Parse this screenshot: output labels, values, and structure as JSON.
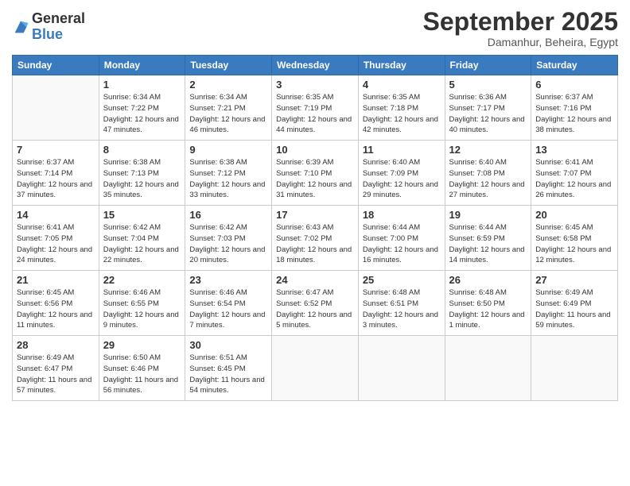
{
  "logo": {
    "general": "General",
    "blue": "Blue"
  },
  "title": "September 2025",
  "location": "Damanhur, Beheira, Egypt",
  "days_header": [
    "Sunday",
    "Monday",
    "Tuesday",
    "Wednesday",
    "Thursday",
    "Friday",
    "Saturday"
  ],
  "weeks": [
    [
      {
        "day": "",
        "sunrise": "",
        "sunset": "",
        "daylight": ""
      },
      {
        "day": "1",
        "sunrise": "Sunrise: 6:34 AM",
        "sunset": "Sunset: 7:22 PM",
        "daylight": "Daylight: 12 hours and 47 minutes."
      },
      {
        "day": "2",
        "sunrise": "Sunrise: 6:34 AM",
        "sunset": "Sunset: 7:21 PM",
        "daylight": "Daylight: 12 hours and 46 minutes."
      },
      {
        "day": "3",
        "sunrise": "Sunrise: 6:35 AM",
        "sunset": "Sunset: 7:19 PM",
        "daylight": "Daylight: 12 hours and 44 minutes."
      },
      {
        "day": "4",
        "sunrise": "Sunrise: 6:35 AM",
        "sunset": "Sunset: 7:18 PM",
        "daylight": "Daylight: 12 hours and 42 minutes."
      },
      {
        "day": "5",
        "sunrise": "Sunrise: 6:36 AM",
        "sunset": "Sunset: 7:17 PM",
        "daylight": "Daylight: 12 hours and 40 minutes."
      },
      {
        "day": "6",
        "sunrise": "Sunrise: 6:37 AM",
        "sunset": "Sunset: 7:16 PM",
        "daylight": "Daylight: 12 hours and 38 minutes."
      }
    ],
    [
      {
        "day": "7",
        "sunrise": "Sunrise: 6:37 AM",
        "sunset": "Sunset: 7:14 PM",
        "daylight": "Daylight: 12 hours and 37 minutes."
      },
      {
        "day": "8",
        "sunrise": "Sunrise: 6:38 AM",
        "sunset": "Sunset: 7:13 PM",
        "daylight": "Daylight: 12 hours and 35 minutes."
      },
      {
        "day": "9",
        "sunrise": "Sunrise: 6:38 AM",
        "sunset": "Sunset: 7:12 PM",
        "daylight": "Daylight: 12 hours and 33 minutes."
      },
      {
        "day": "10",
        "sunrise": "Sunrise: 6:39 AM",
        "sunset": "Sunset: 7:10 PM",
        "daylight": "Daylight: 12 hours and 31 minutes."
      },
      {
        "day": "11",
        "sunrise": "Sunrise: 6:40 AM",
        "sunset": "Sunset: 7:09 PM",
        "daylight": "Daylight: 12 hours and 29 minutes."
      },
      {
        "day": "12",
        "sunrise": "Sunrise: 6:40 AM",
        "sunset": "Sunset: 7:08 PM",
        "daylight": "Daylight: 12 hours and 27 minutes."
      },
      {
        "day": "13",
        "sunrise": "Sunrise: 6:41 AM",
        "sunset": "Sunset: 7:07 PM",
        "daylight": "Daylight: 12 hours and 26 minutes."
      }
    ],
    [
      {
        "day": "14",
        "sunrise": "Sunrise: 6:41 AM",
        "sunset": "Sunset: 7:05 PM",
        "daylight": "Daylight: 12 hours and 24 minutes."
      },
      {
        "day": "15",
        "sunrise": "Sunrise: 6:42 AM",
        "sunset": "Sunset: 7:04 PM",
        "daylight": "Daylight: 12 hours and 22 minutes."
      },
      {
        "day": "16",
        "sunrise": "Sunrise: 6:42 AM",
        "sunset": "Sunset: 7:03 PM",
        "daylight": "Daylight: 12 hours and 20 minutes."
      },
      {
        "day": "17",
        "sunrise": "Sunrise: 6:43 AM",
        "sunset": "Sunset: 7:02 PM",
        "daylight": "Daylight: 12 hours and 18 minutes."
      },
      {
        "day": "18",
        "sunrise": "Sunrise: 6:44 AM",
        "sunset": "Sunset: 7:00 PM",
        "daylight": "Daylight: 12 hours and 16 minutes."
      },
      {
        "day": "19",
        "sunrise": "Sunrise: 6:44 AM",
        "sunset": "Sunset: 6:59 PM",
        "daylight": "Daylight: 12 hours and 14 minutes."
      },
      {
        "day": "20",
        "sunrise": "Sunrise: 6:45 AM",
        "sunset": "Sunset: 6:58 PM",
        "daylight": "Daylight: 12 hours and 12 minutes."
      }
    ],
    [
      {
        "day": "21",
        "sunrise": "Sunrise: 6:45 AM",
        "sunset": "Sunset: 6:56 PM",
        "daylight": "Daylight: 12 hours and 11 minutes."
      },
      {
        "day": "22",
        "sunrise": "Sunrise: 6:46 AM",
        "sunset": "Sunset: 6:55 PM",
        "daylight": "Daylight: 12 hours and 9 minutes."
      },
      {
        "day": "23",
        "sunrise": "Sunrise: 6:46 AM",
        "sunset": "Sunset: 6:54 PM",
        "daylight": "Daylight: 12 hours and 7 minutes."
      },
      {
        "day": "24",
        "sunrise": "Sunrise: 6:47 AM",
        "sunset": "Sunset: 6:52 PM",
        "daylight": "Daylight: 12 hours and 5 minutes."
      },
      {
        "day": "25",
        "sunrise": "Sunrise: 6:48 AM",
        "sunset": "Sunset: 6:51 PM",
        "daylight": "Daylight: 12 hours and 3 minutes."
      },
      {
        "day": "26",
        "sunrise": "Sunrise: 6:48 AM",
        "sunset": "Sunset: 6:50 PM",
        "daylight": "Daylight: 12 hours and 1 minute."
      },
      {
        "day": "27",
        "sunrise": "Sunrise: 6:49 AM",
        "sunset": "Sunset: 6:49 PM",
        "daylight": "Daylight: 11 hours and 59 minutes."
      }
    ],
    [
      {
        "day": "28",
        "sunrise": "Sunrise: 6:49 AM",
        "sunset": "Sunset: 6:47 PM",
        "daylight": "Daylight: 11 hours and 57 minutes."
      },
      {
        "day": "29",
        "sunrise": "Sunrise: 6:50 AM",
        "sunset": "Sunset: 6:46 PM",
        "daylight": "Daylight: 11 hours and 56 minutes."
      },
      {
        "day": "30",
        "sunrise": "Sunrise: 6:51 AM",
        "sunset": "Sunset: 6:45 PM",
        "daylight": "Daylight: 11 hours and 54 minutes."
      },
      {
        "day": "",
        "sunrise": "",
        "sunset": "",
        "daylight": ""
      },
      {
        "day": "",
        "sunrise": "",
        "sunset": "",
        "daylight": ""
      },
      {
        "day": "",
        "sunrise": "",
        "sunset": "",
        "daylight": ""
      },
      {
        "day": "",
        "sunrise": "",
        "sunset": "",
        "daylight": ""
      }
    ]
  ]
}
